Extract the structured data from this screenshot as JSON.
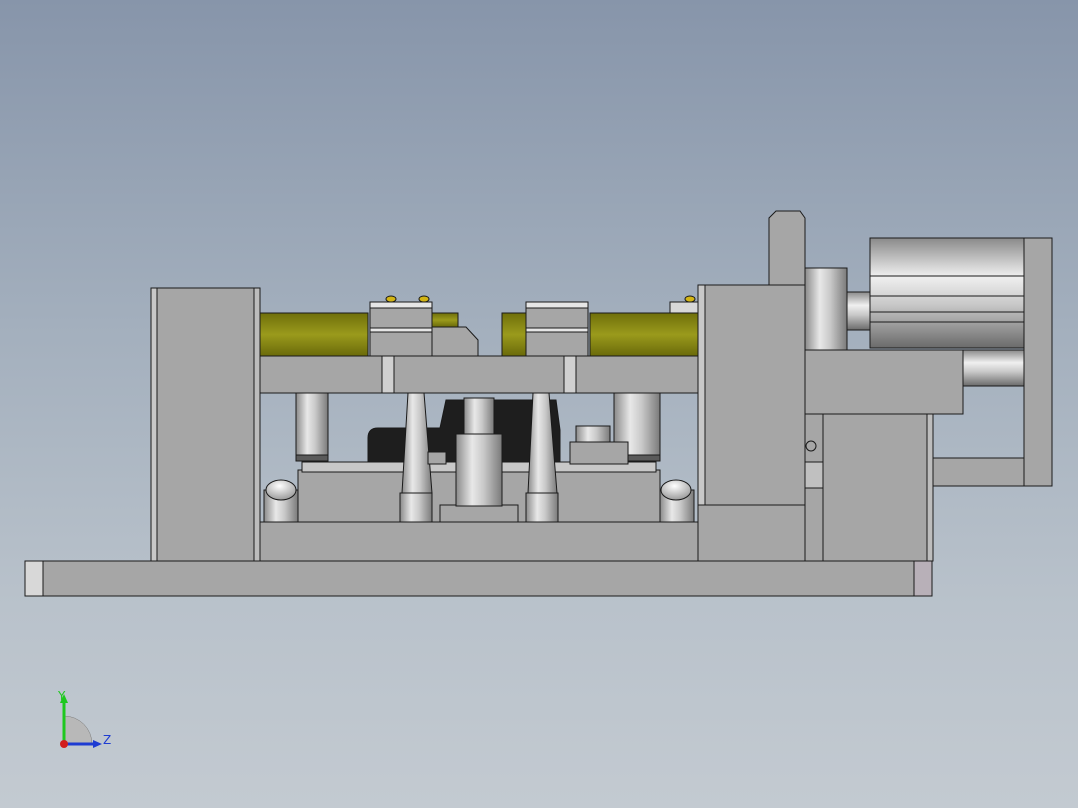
{
  "viewport": {
    "background_top": "#8795aa",
    "background_bottom": "#c3cad1"
  },
  "triad": {
    "y_label": "Y",
    "z_label": "Z",
    "y_color": "#1ec81e",
    "z_color": "#1e3cd2",
    "x_color": "#d21e1e"
  },
  "model": {
    "steel_color": "#a6a6a6",
    "edge_color": "#1a1a1a",
    "olive_color": "#8c8c14",
    "dark_part_color": "#1e1e1e",
    "accent_color": "#d2b414"
  }
}
